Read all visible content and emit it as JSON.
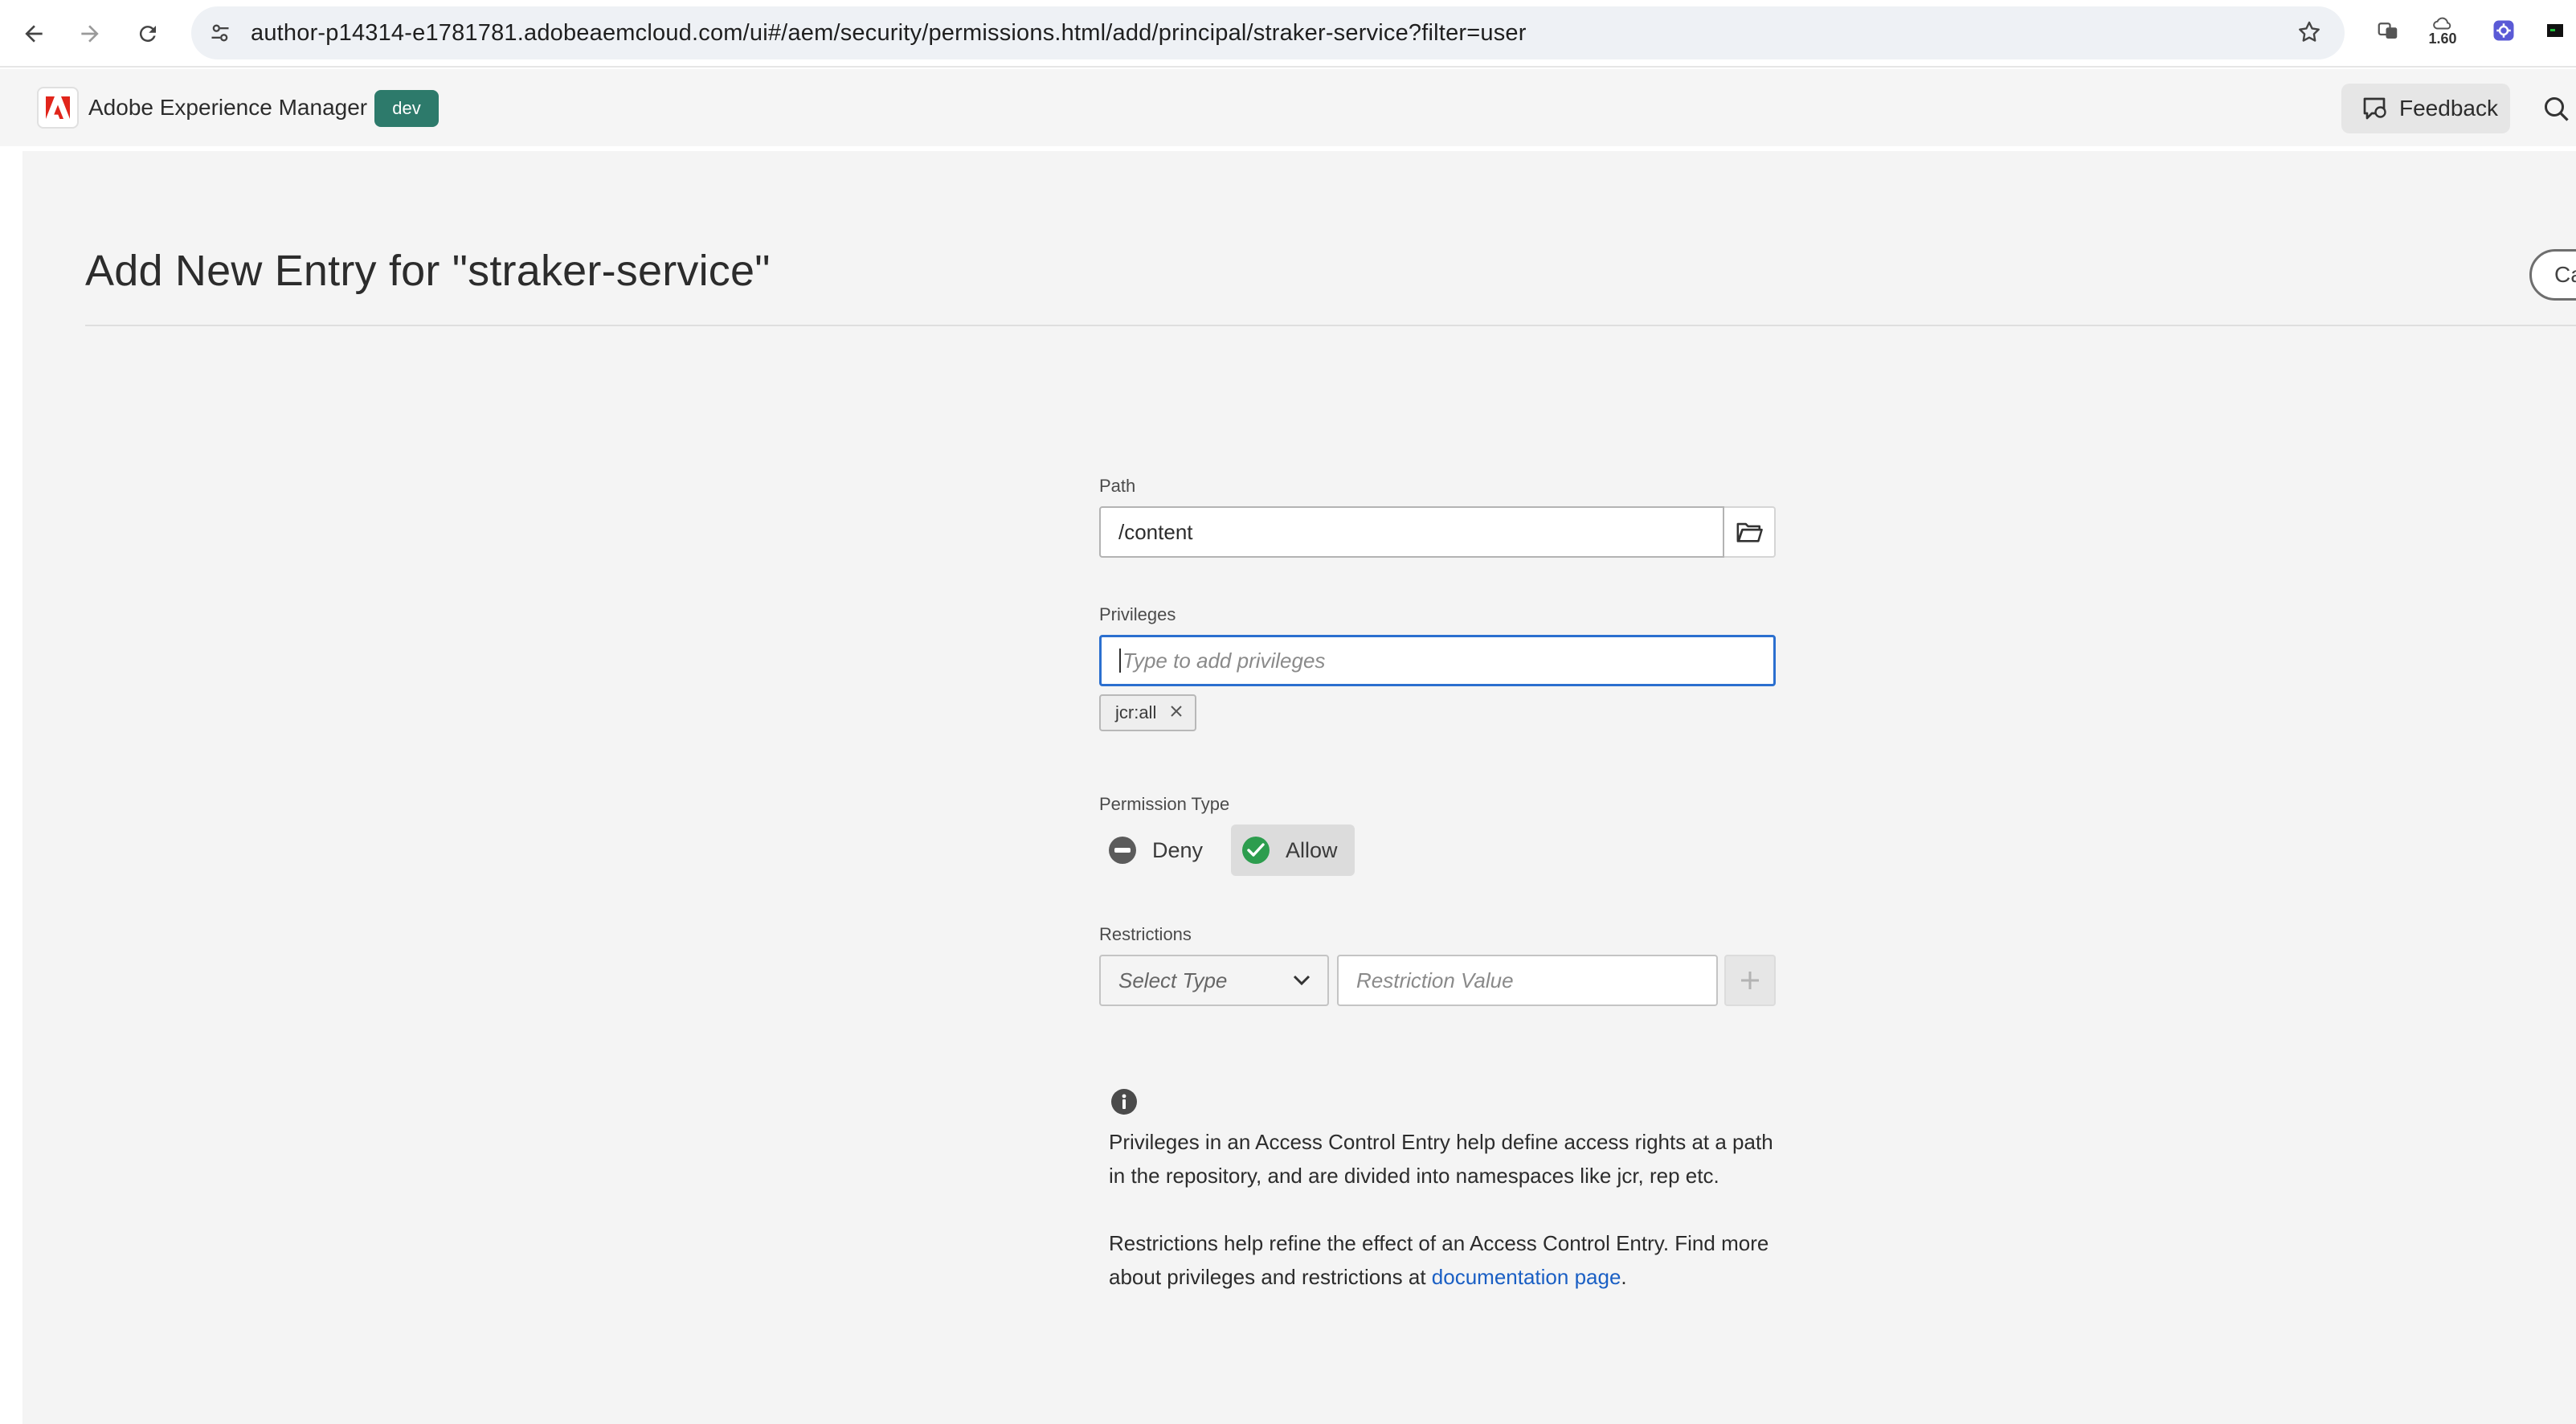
{
  "browser": {
    "url": "author-p14314-e1781781.adobeaemcloud.com/ui#/aem/security/permissions.html/add/principal/straker-service?filter=user",
    "extension_badge": "1.60"
  },
  "header": {
    "app_name": "Adobe Experience Manager",
    "env_badge": "dev",
    "feedback_label": "Feedback"
  },
  "page": {
    "title": "Add New Entry for \"straker-service\"",
    "cancel_label": "Ca"
  },
  "form": {
    "path_label": "Path",
    "path_value": "/content",
    "privileges_label": "Privileges",
    "privileges_placeholder": "Type to add privileges",
    "privilege_tags": [
      "jcr:all"
    ],
    "permission_type_label": "Permission Type",
    "permission_options": {
      "deny": "Deny",
      "allow": "Allow",
      "selected": "allow"
    },
    "restrictions_label": "Restrictions",
    "select_type_placeholder": "Select Type",
    "restriction_value_placeholder": "Restriction Value"
  },
  "info": {
    "paragraph1": "Privileges in an Access Control Entry help define access rights at a path in the repository, and are divided into namespaces like jcr, rep etc.",
    "paragraph2_prefix": "Restrictions help refine the effect of an Access Control Entry. Find more about privileges and restrictions at ",
    "paragraph2_link": "documentation page",
    "paragraph2_suffix": "."
  },
  "colors": {
    "env_badge": "#2d7a6b",
    "focus_blue": "#2b6fcf",
    "allow_green": "#2d9d4e",
    "link_blue": "#1a5fc4"
  },
  "icons": {
    "back": "arrow-left-icon",
    "forward": "arrow-right-icon",
    "reload": "reload-icon",
    "site_info": "tune-icon",
    "bookmark": "star-icon",
    "folder": "folder-icon",
    "deny": "minus-circle-icon",
    "allow": "check-circle-icon",
    "info": "info-icon",
    "search": "search-icon"
  }
}
